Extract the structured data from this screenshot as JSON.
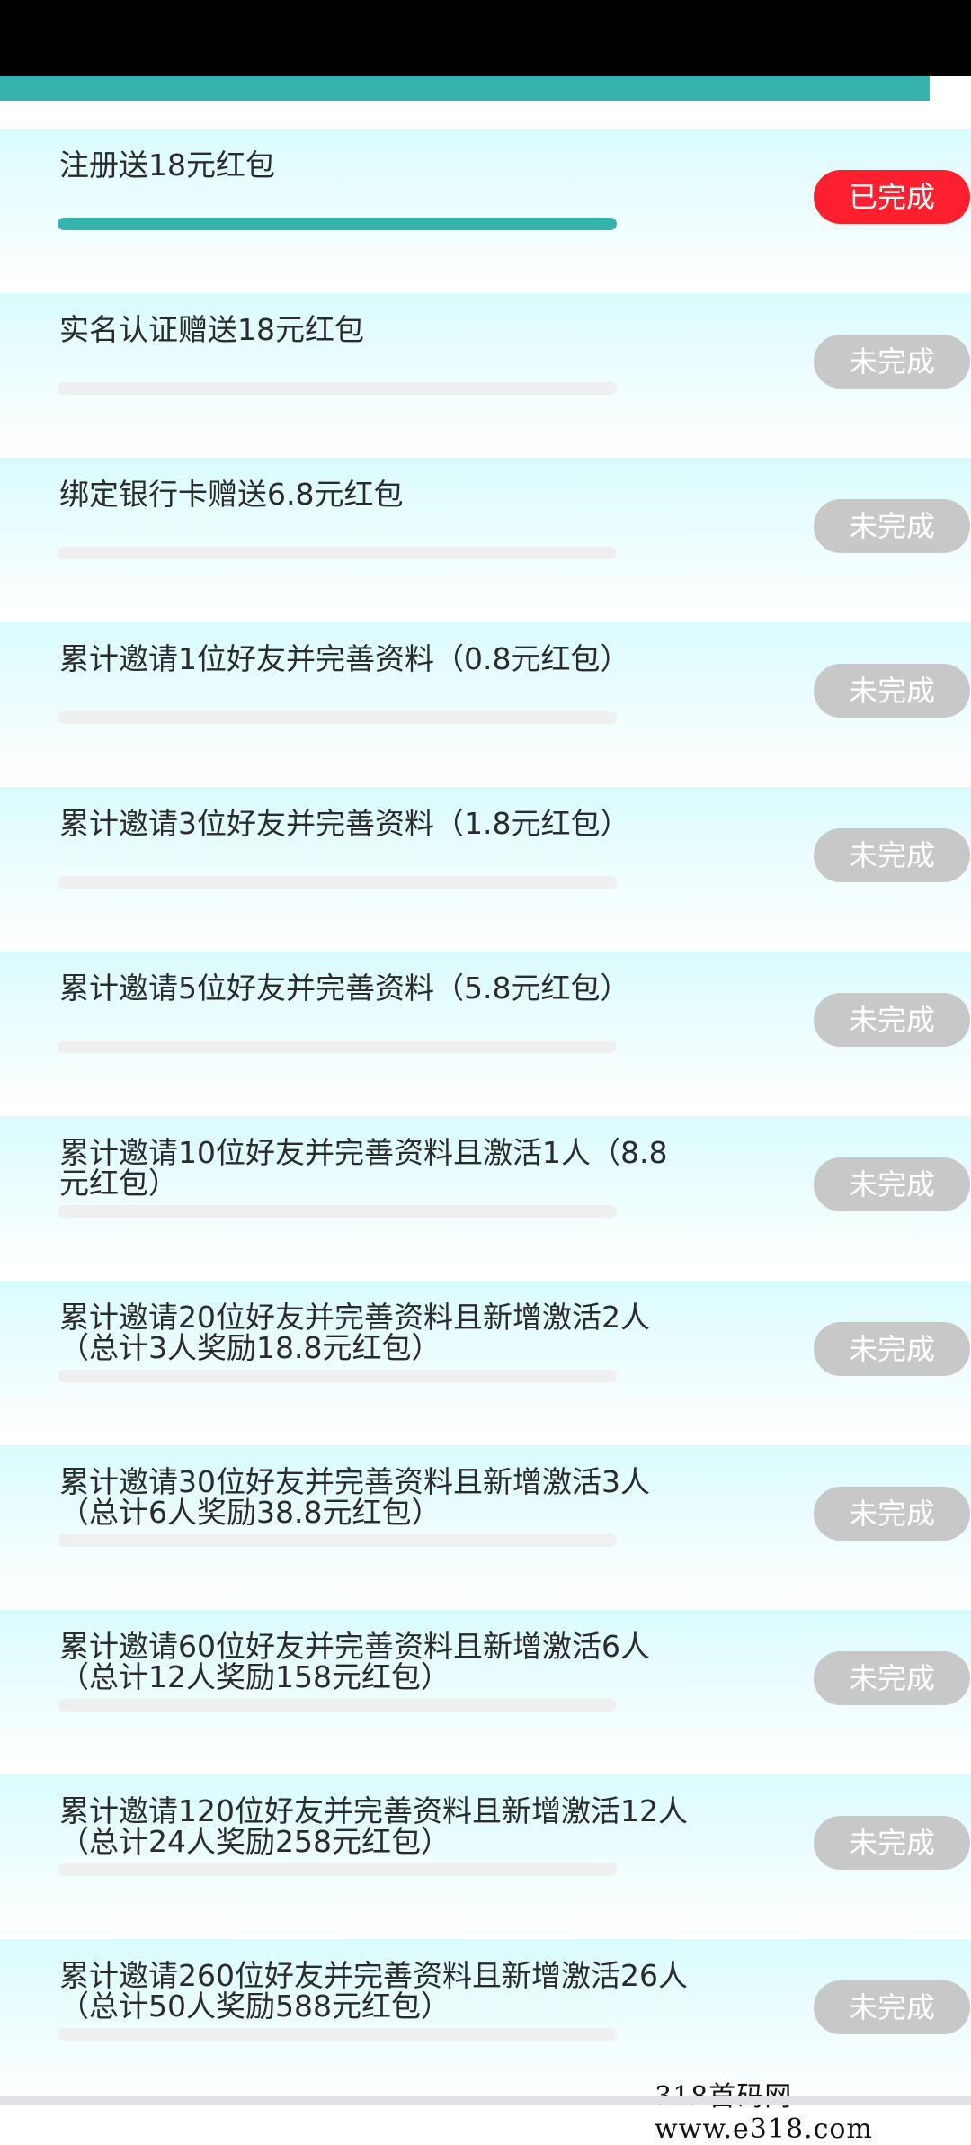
{
  "colors": {
    "accent": "#36b3ad",
    "done": "#ff1f2e",
    "todo": "#c8c8c8"
  },
  "top_progress": {
    "value": 0.957
  },
  "tasks": [
    {
      "title": "注册送18元红包",
      "progress": 1,
      "status_label": "已完成",
      "status": "done"
    },
    {
      "title": "实名认证赠送18元红包",
      "progress": 0,
      "status_label": "未完成",
      "status": "todo"
    },
    {
      "title": "绑定银行卡赠送6.8元红包",
      "progress": 0,
      "status_label": "未完成",
      "status": "todo"
    },
    {
      "title": "累计邀请1位好友并完善资料（0.8元红包）",
      "progress": 0,
      "status_label": "未完成",
      "status": "todo"
    },
    {
      "title": "累计邀请3位好友并完善资料（1.8元红包）",
      "progress": 0,
      "status_label": "未完成",
      "status": "todo"
    },
    {
      "title": "累计邀请5位好友并完善资料（5.8元红包）",
      "progress": 0,
      "status_label": "未完成",
      "status": "todo"
    },
    {
      "title": "累计邀请10位好友并完善资料且激活1人（8.8元红包）",
      "progress": 0,
      "status_label": "未完成",
      "status": "todo"
    },
    {
      "title": "累计邀请20位好友并完善资料且新增激活2人（总计3人奖励18.8元红包）",
      "progress": 0,
      "status_label": "未完成",
      "status": "todo"
    },
    {
      "title": "累计邀请30位好友并完善资料且新增激活3人（总计6人奖励38.8元红包）",
      "progress": 0,
      "status_label": "未完成",
      "status": "todo"
    },
    {
      "title": "累计邀请60位好友并完善资料且新增激活6人（总计12人奖励158元红包）",
      "progress": 0,
      "status_label": "未完成",
      "status": "todo"
    },
    {
      "title": "累计邀请120位好友并完善资料且新增激活12人（总计24人奖励258元红包）",
      "progress": 0,
      "status_label": "未完成",
      "status": "todo"
    },
    {
      "title": "累计邀请260位好友并完善资料且新增激活26人（总计50人奖励588元红包）",
      "progress": 0,
      "status_label": "未完成",
      "status": "todo"
    }
  ],
  "watermark": "318首码网 www.e318.com"
}
